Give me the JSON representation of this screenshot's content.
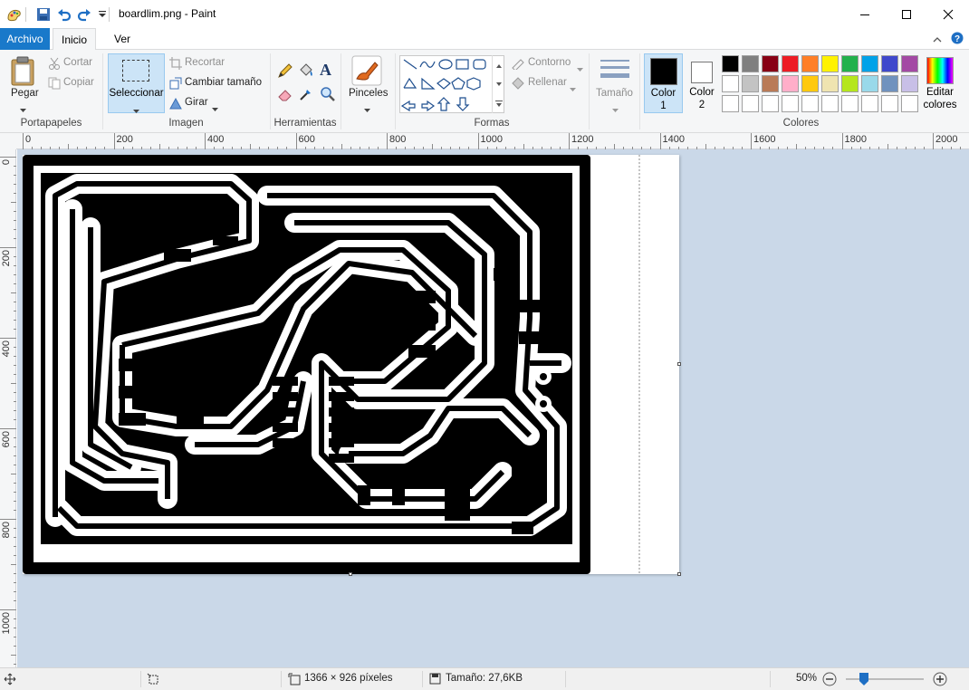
{
  "window": {
    "title": "boardlim.png - Paint"
  },
  "tabs": {
    "file": "Archivo",
    "home": "Inicio",
    "view": "Ver"
  },
  "ribbon": {
    "clipboard": {
      "paste": "Pegar",
      "cut": "Cortar",
      "copy": "Copiar",
      "label": "Portapapeles"
    },
    "image": {
      "select": "Seleccionar",
      "crop": "Recortar",
      "resize": "Cambiar tamaño",
      "rotate": "Girar",
      "label": "Imagen"
    },
    "tools": {
      "label": "Herramientas"
    },
    "brushes": {
      "label": "Pinceles"
    },
    "shapes": {
      "outline": "Contorno",
      "fill": "Rellenar",
      "label": "Formas"
    },
    "size": {
      "label": "Tamaño"
    },
    "colors": {
      "color1": "Color",
      "color1_num": "1",
      "color2": "Color",
      "color2_num": "2",
      "edit_line1": "Editar",
      "edit_line2": "colores",
      "label": "Colores",
      "palette": [
        "#000000",
        "#7f7f7f",
        "#880015",
        "#ed1c24",
        "#ff7f27",
        "#fff200",
        "#22b14c",
        "#00a2e8",
        "#3f48cc",
        "#a349a4",
        "#ffffff",
        "#c3c3c3",
        "#b97a57",
        "#ffaec9",
        "#ffc90e",
        "#efe4b0",
        "#b5e61d",
        "#99d9ea",
        "#7092be",
        "#c8bfe7",
        "#ffffff",
        "#ffffff",
        "#ffffff",
        "#ffffff",
        "#ffffff",
        "#ffffff",
        "#ffffff",
        "#ffffff",
        "#ffffff",
        "#ffffff"
      ],
      "primary": "#000000",
      "secondary": "#ffffff"
    }
  },
  "ruler": {
    "h_labels": [
      "0",
      "200",
      "400",
      "600",
      "800",
      "1000",
      "1200",
      "1400",
      "1600",
      "1800",
      "2000"
    ],
    "v_labels": [
      "0",
      "200",
      "400",
      "600",
      "800",
      "1000"
    ]
  },
  "status": {
    "dimensions": "1366 × 926 píxeles",
    "size": "Tamaño: 27,6KB",
    "zoom": "50%",
    "zoom_fraction": 0.5
  },
  "colors": {
    "accent": "#1979ca",
    "canvas_bg": "#cad8e8"
  }
}
